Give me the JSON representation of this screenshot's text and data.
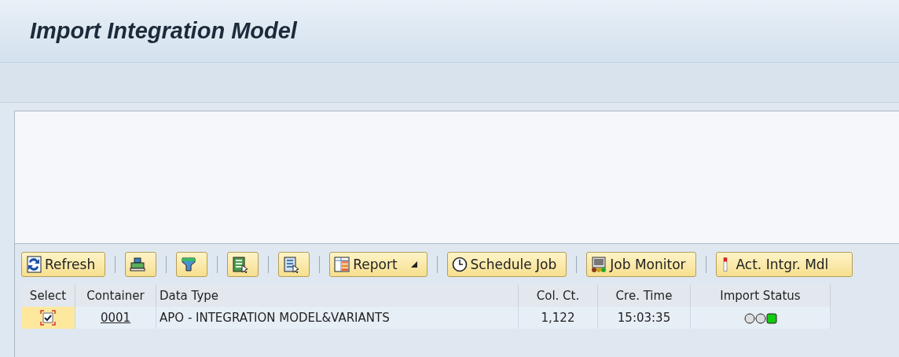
{
  "window": {
    "title": "Import Integration Model"
  },
  "toolbar": {
    "buttons": [
      {
        "kind": "refresh",
        "label": "Refresh"
      },
      {
        "kind": "print"
      },
      {
        "kind": "filter"
      },
      {
        "kind": "export"
      },
      {
        "kind": "layout"
      },
      {
        "kind": "report",
        "label": "Report",
        "dropdown": true
      },
      {
        "kind": "clock",
        "label": "Schedule Job"
      },
      {
        "kind": "monitor",
        "label": "Job Monitor"
      },
      {
        "kind": "activate",
        "label": "Act. Intgr. Mdl"
      }
    ]
  },
  "table": {
    "columns": [
      "Select",
      "Container",
      "Data Type",
      "Col. Ct.",
      "Cre. Time",
      "Import Status"
    ],
    "rows": [
      {
        "checked": true,
        "selected": true,
        "container": "0001",
        "data_type": "APO - INTEGRATION MODEL&VARIANTS",
        "col_ct": "1,122",
        "cre_time": "15:03:35",
        "status_lights": [
          {
            "on": false
          },
          {
            "on": false
          },
          {
            "on": true
          }
        ]
      }
    ]
  }
}
